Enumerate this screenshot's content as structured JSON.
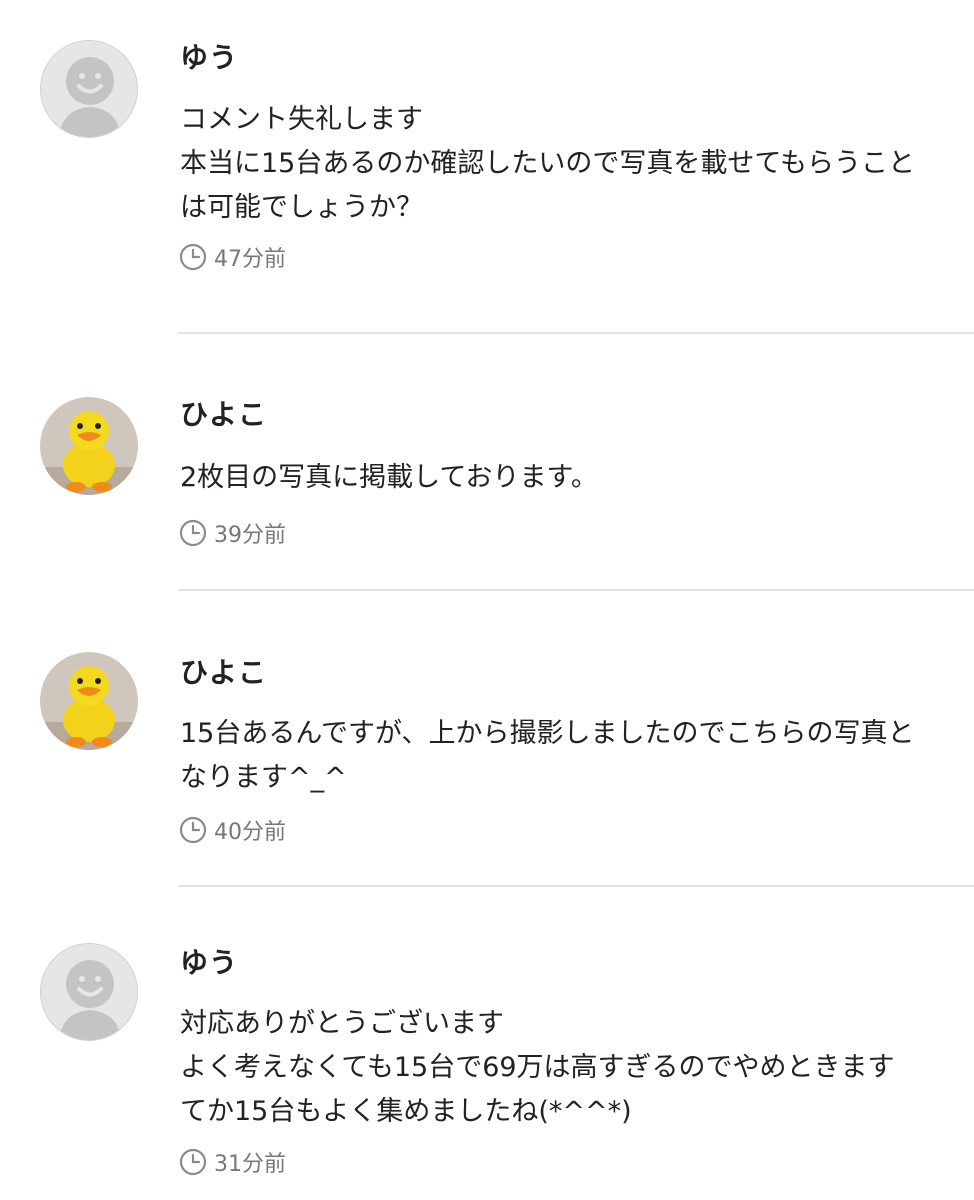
{
  "comments": [
    {
      "author": "ゆう",
      "avatar": "default-face-avatar",
      "text": "コメント失礼します\n本当に15台あるのか確認したいので写真を載せてもらうことは可能でしょうか？",
      "time": "47分前"
    },
    {
      "author": "ひよこ",
      "avatar": "duck-avatar",
      "text": "2枚目の写真に掲載しております。",
      "time": "39分前"
    },
    {
      "author": "ひよこ",
      "avatar": "duck-avatar",
      "text": "15台あるんですが、上から撮影しましたのでこちらの写真となります^_^",
      "time": "40分前"
    },
    {
      "author": "ゆう",
      "avatar": "default-face-avatar",
      "text": "対応ありがとうございます\nよく考えなくても15台で69万は高すぎるのでやめときます\nてか15台もよく集めましたね(*^^*)",
      "time": "31分前"
    }
  ],
  "icons": {
    "time": "clock-icon"
  },
  "colors": {
    "text": "#222222",
    "meta": "#777777",
    "divider": "#e3e3e3",
    "avatar_bg": "#e6e6e6",
    "duck": "#f2d21b",
    "beak": "#f08a1c"
  }
}
